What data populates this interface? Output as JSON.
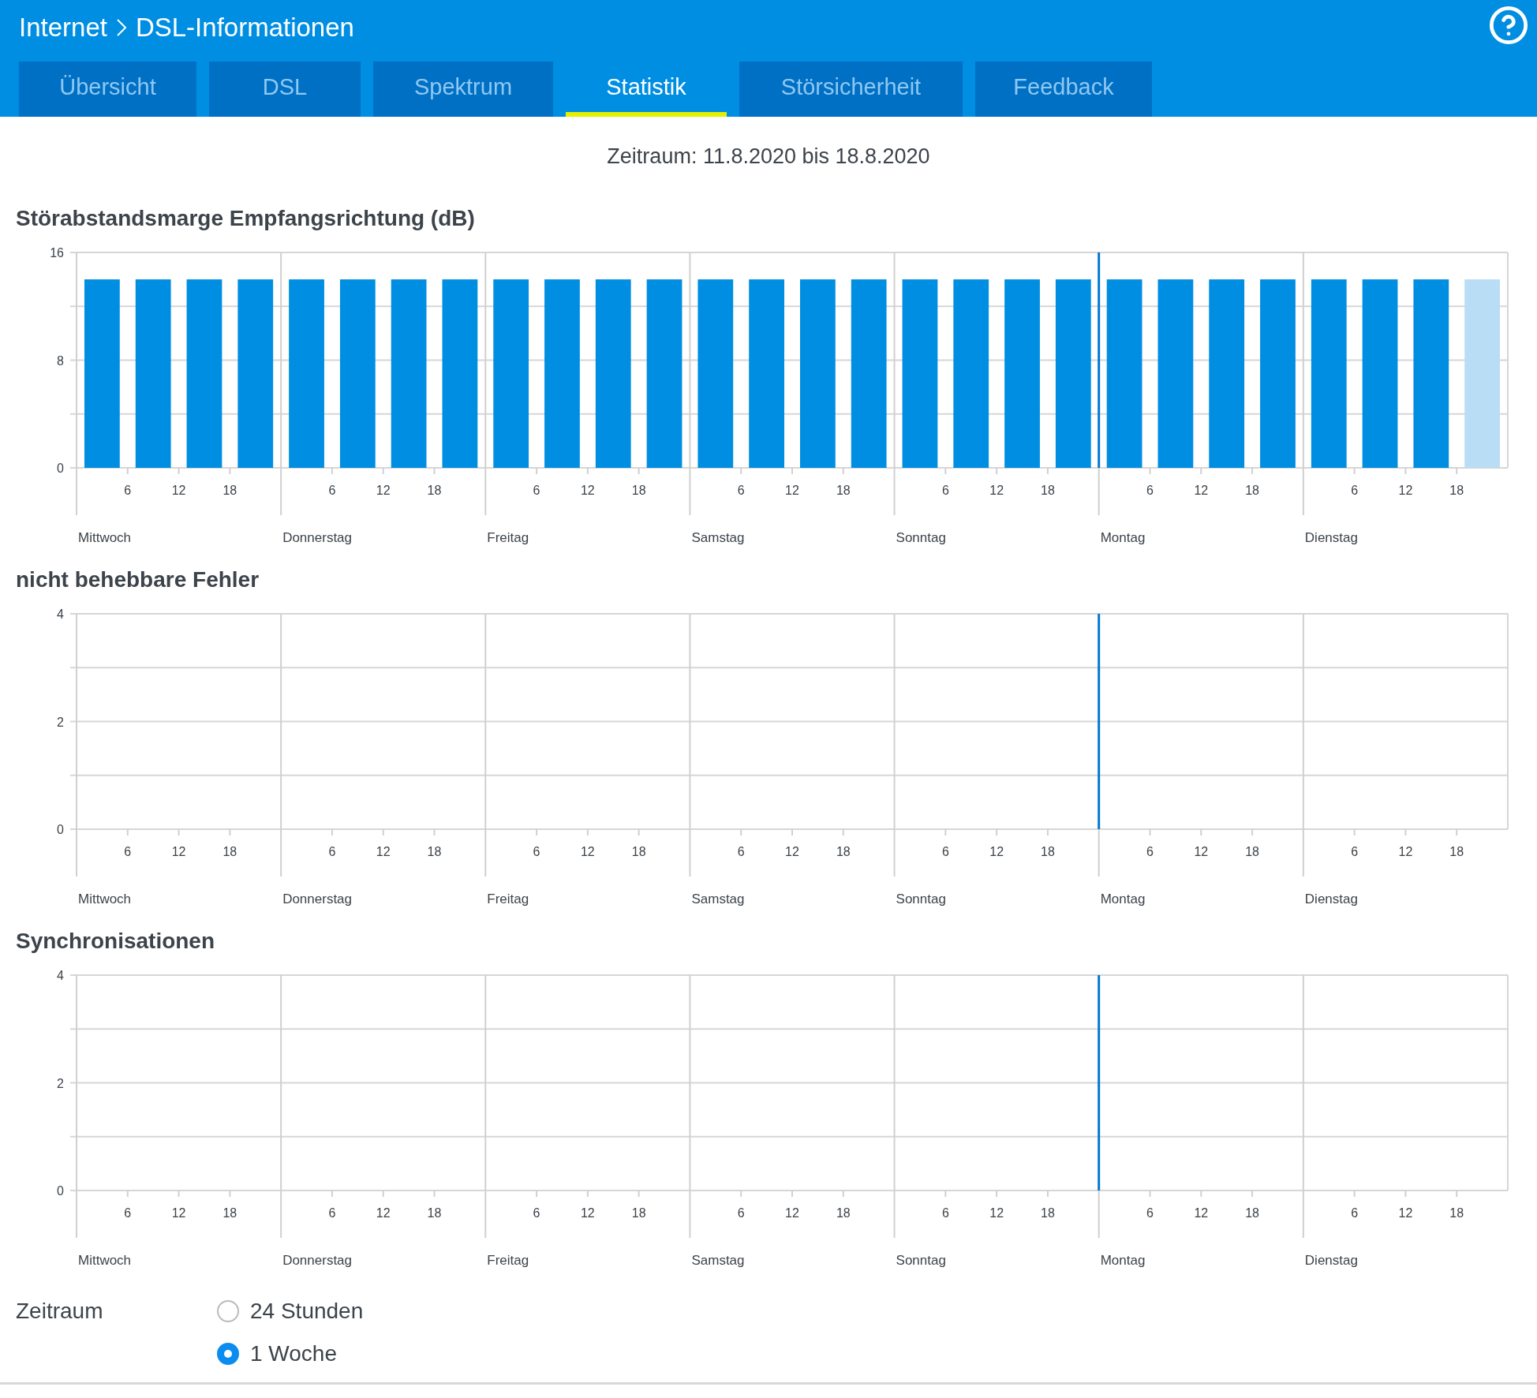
{
  "header": {
    "breadcrumb": [
      "Internet",
      "DSL-Informationen"
    ]
  },
  "tabs": [
    {
      "label": "Übersicht",
      "selected": false
    },
    {
      "label": "DSL",
      "selected": false
    },
    {
      "label": "Spektrum",
      "selected": false
    },
    {
      "label": "Statistik",
      "selected": true
    },
    {
      "label": "Störsicherheit",
      "selected": false
    },
    {
      "label": "Feedback",
      "selected": false
    }
  ],
  "period_text": "Zeitraum: 11.8.2020 bis 18.8.2020",
  "charts": [
    {
      "title": "Störabstandsmarge Empfangsrichtung (dB)",
      "days": [
        {
          "label": "Mittwoch",
          "hours": [
            "6",
            "12",
            "18"
          ]
        },
        {
          "label": "Donnerstag",
          "hours": [
            "6",
            "12",
            "18"
          ]
        },
        {
          "label": "Freitag",
          "hours": [
            "6",
            "12",
            "18"
          ]
        },
        {
          "label": "Samstag",
          "hours": [
            "6",
            "12",
            "18"
          ]
        },
        {
          "label": "Sonntag",
          "hours": [
            "6",
            "12",
            "18"
          ]
        },
        {
          "label": "Montag",
          "hours": [
            "6",
            "12",
            "18"
          ]
        },
        {
          "label": "Dienstag",
          "hours": [
            "6",
            "12",
            "18"
          ]
        }
      ],
      "chart_data": {
        "type": "bar",
        "ylim": [
          0,
          16
        ],
        "yticks": [
          0,
          8,
          16
        ],
        "series": [
          {
            "color": "#008ee3",
            "values": [
              14,
              14,
              14,
              14,
              14,
              14,
              14,
              14,
              14,
              14,
              14,
              14,
              14,
              14,
              14,
              14,
              14,
              14,
              14,
              14,
              14,
              14,
              14,
              14,
              14,
              14,
              14,
              null
            ]
          },
          {
            "color": "#b8ddf5",
            "values": [
              null,
              null,
              null,
              null,
              null,
              null,
              null,
              null,
              null,
              null,
              null,
              null,
              null,
              null,
              null,
              null,
              null,
              null,
              null,
              null,
              null,
              null,
              null,
              null,
              null,
              null,
              null,
              14
            ]
          }
        ]
      }
    },
    {
      "title": "nicht behebbare Fehler",
      "days": [
        {
          "label": "Mittwoch",
          "hours": [
            "6",
            "12",
            "18"
          ]
        },
        {
          "label": "Donnerstag",
          "hours": [
            "6",
            "12",
            "18"
          ]
        },
        {
          "label": "Freitag",
          "hours": [
            "6",
            "12",
            "18"
          ]
        },
        {
          "label": "Samstag",
          "hours": [
            "6",
            "12",
            "18"
          ]
        },
        {
          "label": "Sonntag",
          "hours": [
            "6",
            "12",
            "18"
          ]
        },
        {
          "label": "Montag",
          "hours": [
            "6",
            "12",
            "18"
          ]
        },
        {
          "label": "Dienstag",
          "hours": [
            "6",
            "12",
            "18"
          ]
        }
      ],
      "chart_data": {
        "type": "bar",
        "ylim": [
          0,
          4
        ],
        "yticks": [
          0,
          2,
          4
        ],
        "series": [
          {
            "values": [
              0,
              0,
              0,
              0,
              0,
              0,
              0,
              0,
              0,
              0,
              0,
              0,
              0,
              0,
              0,
              0,
              0,
              0,
              0,
              0,
              0,
              0,
              0,
              0,
              0,
              0,
              0,
              0
            ]
          }
        ]
      }
    },
    {
      "title": "Synchronisationen",
      "days": [
        {
          "label": "Mittwoch",
          "hours": [
            "6",
            "12",
            "18"
          ]
        },
        {
          "label": "Donnerstag",
          "hours": [
            "6",
            "12",
            "18"
          ]
        },
        {
          "label": "Freitag",
          "hours": [
            "6",
            "12",
            "18"
          ]
        },
        {
          "label": "Samstag",
          "hours": [
            "6",
            "12",
            "18"
          ]
        },
        {
          "label": "Sonntag",
          "hours": [
            "6",
            "12",
            "18"
          ]
        },
        {
          "label": "Montag",
          "hours": [
            "6",
            "12",
            "18"
          ]
        },
        {
          "label": "Dienstag",
          "hours": [
            "6",
            "12",
            "18"
          ]
        }
      ],
      "chart_data": {
        "type": "bar",
        "ylim": [
          0,
          4
        ],
        "yticks": [
          0,
          2,
          4
        ],
        "series": [
          {
            "values": [
              0,
              0,
              0,
              0,
              0,
              0,
              0,
              0,
              0,
              0,
              0,
              0,
              0,
              0,
              0,
              0,
              0,
              0,
              0,
              0,
              0,
              0,
              0,
              0,
              0,
              0,
              0,
              0
            ]
          }
        ]
      }
    }
  ],
  "period_select": {
    "label": "Zeitraum",
    "options": [
      {
        "label": "24 Stunden",
        "selected": false
      },
      {
        "label": "1 Woche",
        "selected": true
      }
    ]
  }
}
